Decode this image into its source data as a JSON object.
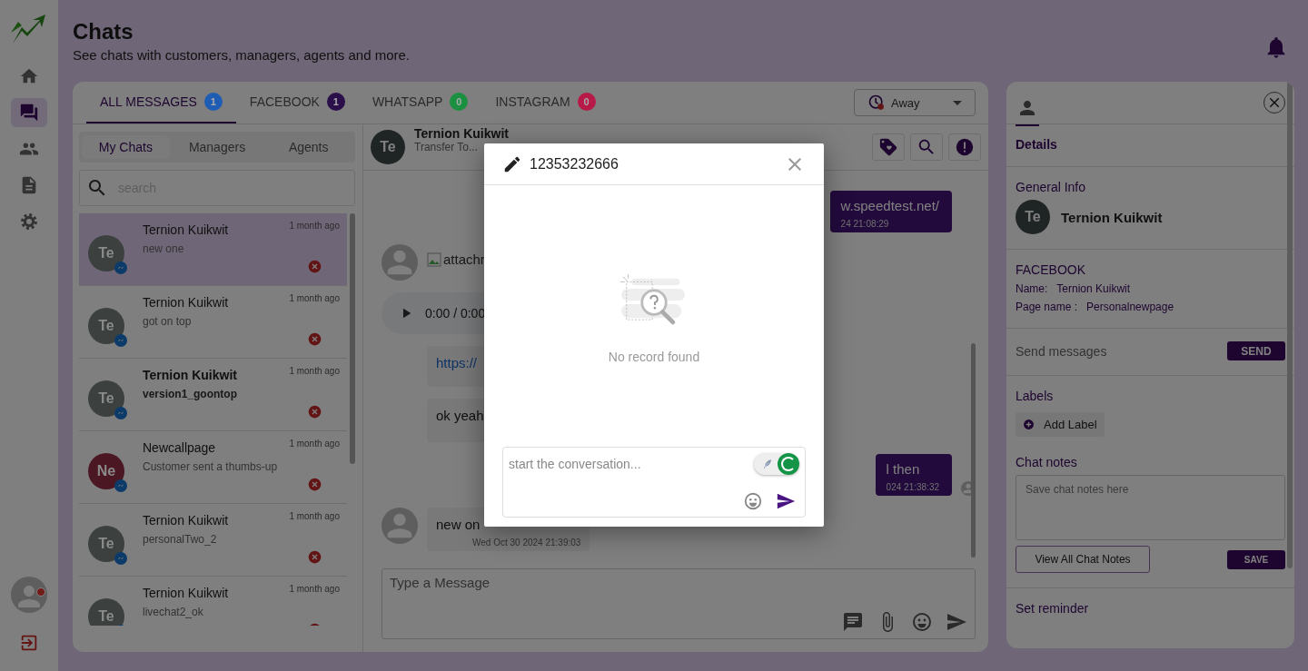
{
  "nav": {
    "items": [
      {
        "kind": "home",
        "selected": false
      },
      {
        "kind": "chats",
        "selected": true
      },
      {
        "kind": "people",
        "selected": false
      },
      {
        "kind": "document",
        "selected": false
      },
      {
        "kind": "settings",
        "selected": false
      }
    ],
    "user": {
      "online": false
    }
  },
  "header": {
    "title": "Chats",
    "subtitle": "See chats with customers, managers, agents and more."
  },
  "tabs": [
    {
      "label": "ALL MESSAGES",
      "count": "1",
      "color": "#1f5db5",
      "selected": true
    },
    {
      "label": "FACEBOOK",
      "count": "1",
      "color": "#2a0f4a",
      "selected": false
    },
    {
      "label": "WHATSAPP",
      "count": "0",
      "color": "#1a9040",
      "selected": false
    },
    {
      "label": "INSTAGRAM",
      "count": "0",
      "color": "#b81a48",
      "selected": false
    }
  ],
  "status_select": {
    "value": "Away"
  },
  "subtabs": [
    {
      "label": "My Chats",
      "selected": true
    },
    {
      "label": "Managers",
      "selected": false
    },
    {
      "label": "Agents",
      "selected": false
    }
  ],
  "search": {
    "placeholder": "search"
  },
  "conversations": [
    {
      "initials": "Te",
      "name": "Ternion Kuikwit",
      "preview": "new one",
      "time": "1 month ago",
      "color": "#3c4140",
      "selected": true,
      "unread": false
    },
    {
      "initials": "Te",
      "name": "Ternion Kuikwit",
      "preview": "got on top",
      "time": "1 month ago",
      "color": "#3c4140",
      "selected": false,
      "unread": false
    },
    {
      "initials": "Te",
      "name": "Ternion Kuikwit",
      "preview": "version1_goontop",
      "time": "1 month ago",
      "color": "#3c4140",
      "selected": false,
      "unread": true
    },
    {
      "initials": "Ne",
      "name": "Newcallpage",
      "preview": "Customer sent a thumbs-up",
      "time": "1 month ago",
      "color": "#4a1722",
      "selected": false,
      "unread": false
    },
    {
      "initials": "Te",
      "name": "Ternion Kuikwit",
      "preview": "personalTwo_2",
      "time": "1 month ago",
      "color": "#3c4140",
      "selected": false,
      "unread": false
    },
    {
      "initials": "Te",
      "name": "Ternion Kuikwit",
      "preview": "livechat2_ok",
      "time": "1 month ago",
      "color": "#3c4140",
      "selected": false,
      "unread": false
    }
  ],
  "chat": {
    "initials": "Te",
    "name": "Ternion Kuikwit",
    "status": "Transfer To...",
    "messages": [
      {
        "kind": "text",
        "outgoing": true,
        "text": "w.speedtest.net/",
        "time": "24 21:08:29",
        "avatar": false
      },
      {
        "kind": "attachment",
        "outgoing": false,
        "text": "attachr",
        "avatar": true
      },
      {
        "kind": "audio",
        "outgoing": false,
        "text": "0:00 / 0:00",
        "avatar": false
      },
      {
        "kind": "link",
        "outgoing": false,
        "text": "https://",
        "avatar": false
      },
      {
        "kind": "text",
        "outgoing": false,
        "text": "ok yeah",
        "avatar": false
      },
      {
        "kind": "text",
        "outgoing": true,
        "text": "l then",
        "time": "024 21:38:32",
        "avatar": true
      },
      {
        "kind": "text",
        "outgoing": false,
        "text": "new on",
        "time": "Wed Oct 30 2024 21:39:03",
        "avatar": true
      }
    ],
    "composer": {
      "placeholder": "Type a Message"
    }
  },
  "details": {
    "heading": "Details",
    "general_label": "General Info",
    "initials": "Te",
    "name": "Ternion Kuikwit",
    "channel": "FACEBOOK",
    "name_label": "Name:",
    "name_value": "Ternion Kuikwit",
    "page_label": "Page name :",
    "page_value": "Personalnewpage",
    "send_label": "Send messages",
    "send_button": "SEND",
    "labels_heading": "Labels",
    "add_label": "Add Label",
    "notes_heading": "Chat notes",
    "notes_placeholder": "Save chat notes here",
    "view_notes": "View All Chat Notes",
    "save_button": "SAVE",
    "reminder": "Set reminder"
  },
  "modal": {
    "title": "12353232666",
    "empty": "No record found",
    "placeholder": "start the conversation...",
    "toggle": {
      "on": true
    }
  }
}
